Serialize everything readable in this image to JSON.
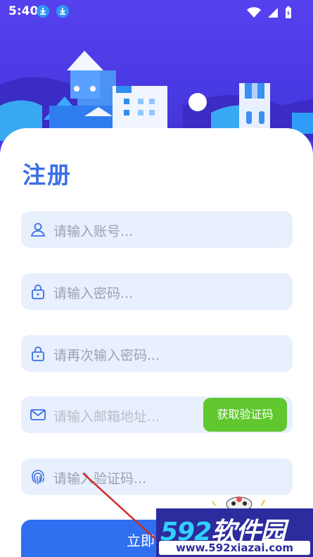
{
  "status_bar": {
    "time": "5:40"
  },
  "form": {
    "title": "注册",
    "account_placeholder": "请输入账号...",
    "password_placeholder": "请输入密码...",
    "confirm_password_placeholder": "请再次输入密码...",
    "email_placeholder": "请输入邮箱地址...",
    "get_code_label": "获取验证码",
    "code_placeholder": "请输入验证码...",
    "submit_label": "立即"
  },
  "watermark": {
    "title_num": "592",
    "title_text": "软件园",
    "url": "www.592xiazai.com"
  },
  "colors": {
    "header": "#4b3be6",
    "accent": "#3b6fe6",
    "field_bg": "#e8effd",
    "code_button": "#60c82e"
  }
}
